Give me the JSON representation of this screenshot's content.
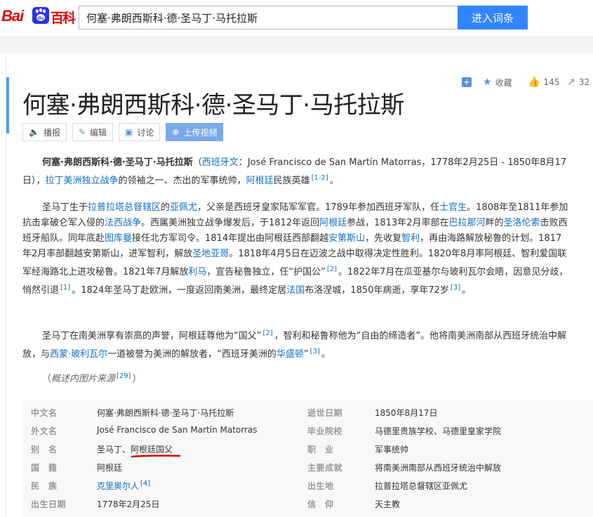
{
  "header": {
    "logo_left": "Bai",
    "logo_right": "百科",
    "search_value": "何塞·弗朗西斯科·德·圣马丁·马托拉斯",
    "search_button": "进入词条"
  },
  "topbar": {
    "collect": "收藏",
    "like_count": "145",
    "share_count": "32"
  },
  "title": "何塞·弗朗西斯科·德·圣马丁·马托拉斯",
  "tools": {
    "play": "播报",
    "edit": "编辑",
    "discuss": "讨论",
    "upload": "上传视频"
  },
  "paragraph1": {
    "name": "何塞·弗朗西斯科·德·圣马丁·马托拉斯",
    "open": "（",
    "lang_link": "西班牙文",
    "spanish": "：José Francisco de San Martín Matorras，1778年2月25日 - 1850年8月17日），",
    "war_link": "拉丁美洲独立战争",
    "mid": "的领袖之一、杰出的军事统帅，",
    "arg_link": "阿根廷",
    "end": "民族英雄",
    "ref": "[1-2]",
    "period": "。"
  },
  "paragraph2": {
    "t1": "圣马丁生于",
    "l1": "拉普拉塔总督辖区",
    "t2": "的",
    "l2": "亚佩尤",
    "t3": "，父亲是西班牙皇家陆军军官。1789年参加西班牙军队，任",
    "l3": "士官生",
    "t4": "。1808年至1811年参加抗击拿破仑军入侵的",
    "l4": "法西战争",
    "t5": "。西属美洲独立战争爆发后，于1812年返回",
    "l5": "阿根廷",
    "t6": "参战，1813年2月率部在",
    "l6": "巴拉那河",
    "t7": "畔的",
    "l7": "圣洛伦索",
    "t8": "击败西班牙船队。同年底赴",
    "l8": "图库曼",
    "t9": "接任北方军司令。1814年提出由阿根廷西部翻越",
    "l9": "安第斯山",
    "t10": "，先收复",
    "l10": "智利",
    "t11": "，再由海路解放秘鲁的计划。1817年2月率部翻越安第斯山，进军智利，解放",
    "l11": "圣地亚哥",
    "t12": "。1818年4月5日在迈波之战中取得决定性胜利。1820年8月率阿根廷、智利爱国联军经海路北上进攻秘鲁。1821年7月解放",
    "l12": "利马",
    "t13": "，宣告秘鲁独立，任“护国公”",
    "r1": "[2]",
    "t14": "。1822年7月在瓜亚基尔与玻利瓦尔会晤，因意见分歧，悄然引退",
    "r2": "[1]",
    "t15": "。1824年圣马丁赴欧洲，一度返回南美洲，最终定居",
    "l13": "法国",
    "t16": "布洛涅城，1850年病逝，享年72岁",
    "r3": "[3]",
    "t17": "。"
  },
  "paragraph3": {
    "t1": "圣马丁在南美洲享有崇高的声誉，阿根廷尊他为“国父”",
    "r1": "[2]",
    "t2": "，智利和秘鲁称他为“自由的缔造者”。他将南美洲南部从西班牙统治中解放，与",
    "l1": "西蒙·玻利瓦尔",
    "t3": "一道被誉为美洲的解放者，“西班牙美洲的",
    "l2": "华盛顿",
    "t4": "”",
    "r2": "[3]",
    "t5": "。"
  },
  "image_source": {
    "open": "（",
    "text": "概述内图片来源",
    "ref": "[29]",
    "close": "）"
  },
  "info": {
    "rows": [
      {
        "k1": "中文名",
        "v1": "何塞·弗朗西斯科·德·圣马丁·马托拉斯",
        "k2": "逝世日期",
        "v2": "1850年8月17日"
      },
      {
        "k1": "外文名",
        "v1": "José Francisco de San Martín Matorras",
        "k2": "毕业院校",
        "v2": "马德里贵族学校、马德里皇家学院"
      },
      {
        "k1": "别　名",
        "v1": "圣马丁、阿根廷国父",
        "k2": "职　业",
        "v2": "军事统帅"
      },
      {
        "k1": "国　籍",
        "v1": "阿根廷",
        "k2": "主要成就",
        "v2": "将南美洲南部从西班牙统治中解放"
      },
      {
        "k1": "民　族",
        "v1": "克里奥尔人",
        "v1_ref": "[4]",
        "k2": "出生地",
        "v2": "拉普拉塔总督辖区亚佩尤"
      },
      {
        "k1": "出生日期",
        "v1": "1778年2月25日",
        "k2": "信　仰",
        "v2": "天主教"
      }
    ]
  },
  "colors": {
    "brand_red": "#e10602",
    "link_blue": "#136ec2",
    "button_blue": "#3385ff",
    "annotation_red": "#e00000"
  },
  "icons": [
    "baidu-paw-icon",
    "plus-icon",
    "star-icon",
    "thumbs-up-icon",
    "share-icon",
    "speaker-icon",
    "pencil-icon",
    "chat-icon",
    "plus-circle-icon"
  ]
}
